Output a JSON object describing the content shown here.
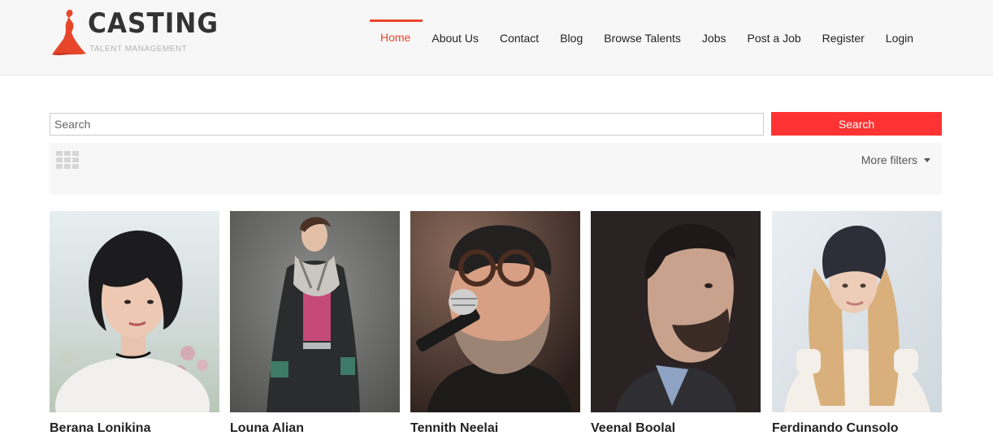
{
  "brand": {
    "name": "CASTING",
    "tagline": "TALENT MANAGEMENT",
    "accent": "#e8462b"
  },
  "nav": {
    "items": [
      {
        "label": "Home",
        "active": true
      },
      {
        "label": "About Us"
      },
      {
        "label": "Contact"
      },
      {
        "label": "Blog"
      },
      {
        "label": "Browse Talents"
      },
      {
        "label": "Jobs"
      },
      {
        "label": "Post a Job"
      },
      {
        "label": "Register"
      },
      {
        "label": "Login"
      }
    ]
  },
  "search": {
    "placeholder": "Search",
    "value": "",
    "button_label": "Search",
    "button_color": "#ff3333"
  },
  "filters": {
    "view_icon": "grid-icon",
    "more_filters_label": "More filters"
  },
  "talents": [
    {
      "name": "Berana Lonikina"
    },
    {
      "name": "Louna Alian"
    },
    {
      "name": "Tennith Neelai"
    },
    {
      "name": "Veenal Boolal"
    },
    {
      "name": "Ferdinando Cunsolo"
    }
  ]
}
